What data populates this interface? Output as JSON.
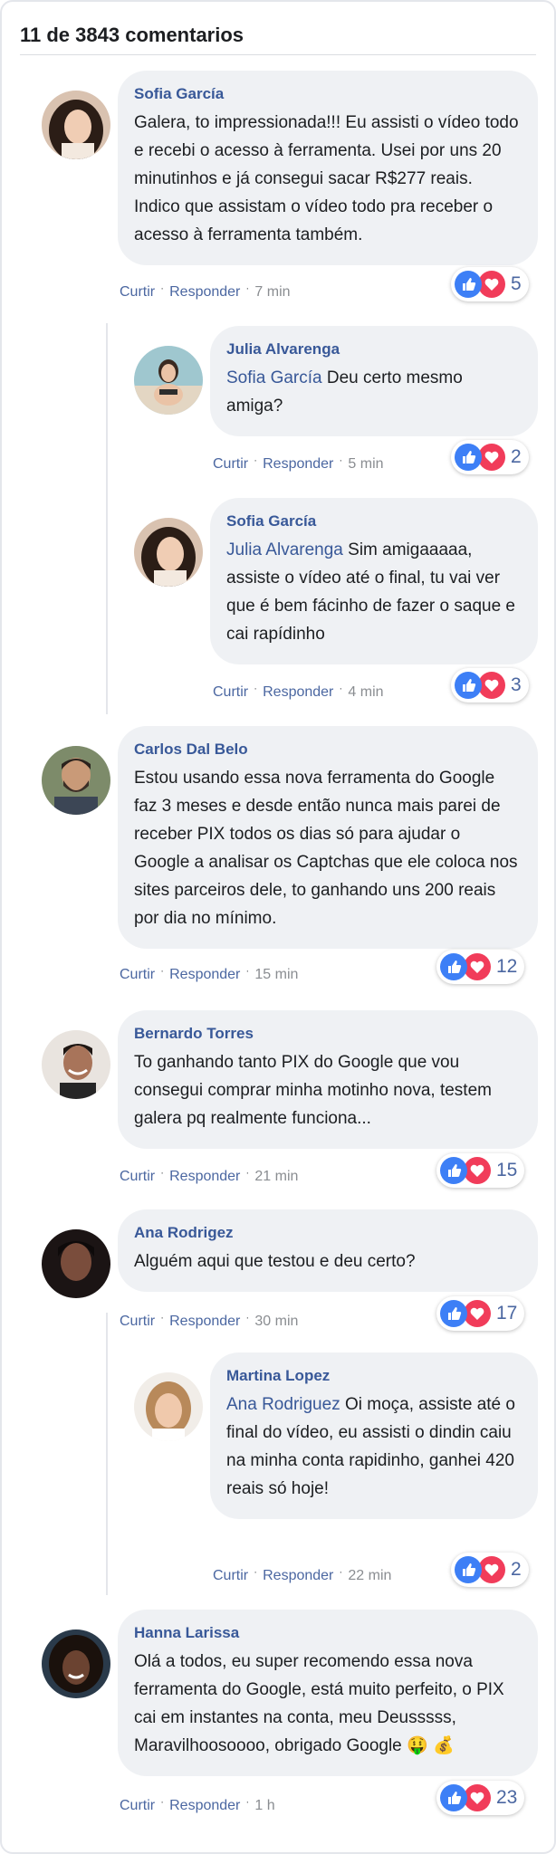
{
  "header": {
    "title": "11 de 3843 comentarios"
  },
  "actions": {
    "like": "Curtir",
    "reply": "Responder",
    "separator": "·"
  },
  "comments": [
    {
      "author": "Sofia García",
      "mention": "",
      "text": "Galera, to impressionada!!! Eu assisti o vídeo todo e recebi o acesso à ferramenta. Usei por uns 20 minutinhos e já consegui sacar R$277 reais. Indico que assistam o vídeo todo pra receber o acesso à ferramenta também.",
      "time": "7 min",
      "reactions": "5",
      "avatar_icon": "woman-long-dark-hair-avatar"
    },
    {
      "author": "Julia Alvarenga",
      "mention": "Sofia García",
      "text": " Deu certo mesmo amiga?",
      "time": "5 min",
      "reactions": "2",
      "avatar_icon": "woman-beach-avatar"
    },
    {
      "author": "Sofia García",
      "mention": "Julia Alvarenga",
      "text": " Sim amigaaaaa, assiste o vídeo até o final, tu vai ver que é bem fácinho de fazer o saque e cai rapídinho",
      "time": "4 min",
      "reactions": "3",
      "avatar_icon": "woman-long-dark-hair-avatar"
    },
    {
      "author": "Carlos Dal Belo",
      "mention": "",
      "text": "Estou usando essa nova ferramenta do Google faz 3 meses e desde então nunca mais parei de receber PIX todos os dias só para ajudar o Google a analisar os Captchas que ele coloca nos sites parceiros dele, to ganhando uns 200 reais por dia no mínimo.",
      "time": "15 min",
      "reactions": "12",
      "avatar_icon": "man-beard-avatar"
    },
    {
      "author": "Bernardo Torres",
      "mention": "",
      "text": "To ganhando tanto PIX do Google que vou consegui comprar minha motinho nova, testem galera pq realmente funciona...",
      "time": "21 min",
      "reactions": "15",
      "avatar_icon": "man-smiling-avatar"
    },
    {
      "author": "Ana Rodrigez",
      "mention": "",
      "text": "Alguém aqui que testou e deu certo?",
      "time": "30 min",
      "reactions": "17",
      "avatar_icon": "woman-dark-avatar"
    },
    {
      "author": "Martina Lopez",
      "mention": "Ana Rodriguez",
      "text": " Oi moça, assiste até o final do vídeo, eu assisti o dindin caiu na minha conta rapidinho, ganhei 420 reais só hoje!",
      "time": "22 min",
      "reactions": "2",
      "avatar_icon": "woman-blonde-avatar"
    },
    {
      "author": "Hanna Larissa",
      "mention": "",
      "text": "Olá a todos, eu super recomendo essa nova ferramenta do Google, está muito perfeito, o PIX cai em instantes na conta, meu Deusssss, Maravilhoosoooo, obrigado Google 🤑 💰",
      "time": "1 h",
      "reactions": "23",
      "avatar_icon": "woman-curly-hair-avatar"
    }
  ],
  "colors": {
    "link": "#385898",
    "bubble": "#eff1f4",
    "like": "#3d7ff6",
    "love": "#f13c5a",
    "time": "#8a8d91"
  }
}
